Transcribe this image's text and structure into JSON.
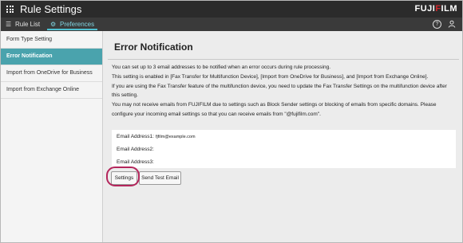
{
  "header": {
    "app_title": "Rule Settings",
    "brand_prefix": "FUJI",
    "brand_accent": "F",
    "brand_suffix": "ILM",
    "help_icon": "?",
    "user_icon": "user-icon"
  },
  "tabs": [
    {
      "label": "Rule List",
      "icon": "list-icon"
    },
    {
      "label": "Preferences",
      "icon": "gear-icon",
      "active": true
    }
  ],
  "sidebar": {
    "items": [
      {
        "label": "Form Type Setting"
      },
      {
        "label": "Error Notification",
        "active": true
      },
      {
        "label": "Import from OneDrive for Business"
      },
      {
        "label": "Import from Exchange Online"
      }
    ]
  },
  "main": {
    "title": "Error Notification",
    "description": [
      "You can set up to 3 email addresses to be notified when an error occurs during rule processing.",
      "This setting is enabled in [Fax Transfer for Multifunction Device], [Import from OneDrive for Business], and [Import from Exchange Online].",
      "If you are using the Fax Transfer feature of the multifunction device, you need to update the Fax Transfer Settings on the multifunction device after this setting.",
      "You may not receive emails from FUJIFILM due to settings such as Block Sender settings or blocking of emails from specific domains. Please configure your incoming email settings so that you can receive emails from \"@fujifilm.com\"."
    ],
    "addresses": [
      {
        "label": "Email Address1:",
        "value": "fjfilm@example.com"
      },
      {
        "label": "Email Address2:",
        "value": ""
      },
      {
        "label": "Email Address3:",
        "value": ""
      }
    ],
    "buttons": {
      "settings": "Settings",
      "send_test": "Send Test Email"
    }
  },
  "colors": {
    "topbar": "#2b2b2b",
    "active_sidebar": "#4aa3ad",
    "active_tab": "#7fd3e0",
    "brand_accent": "#d3262b",
    "highlight_ring": "#b4265c"
  }
}
